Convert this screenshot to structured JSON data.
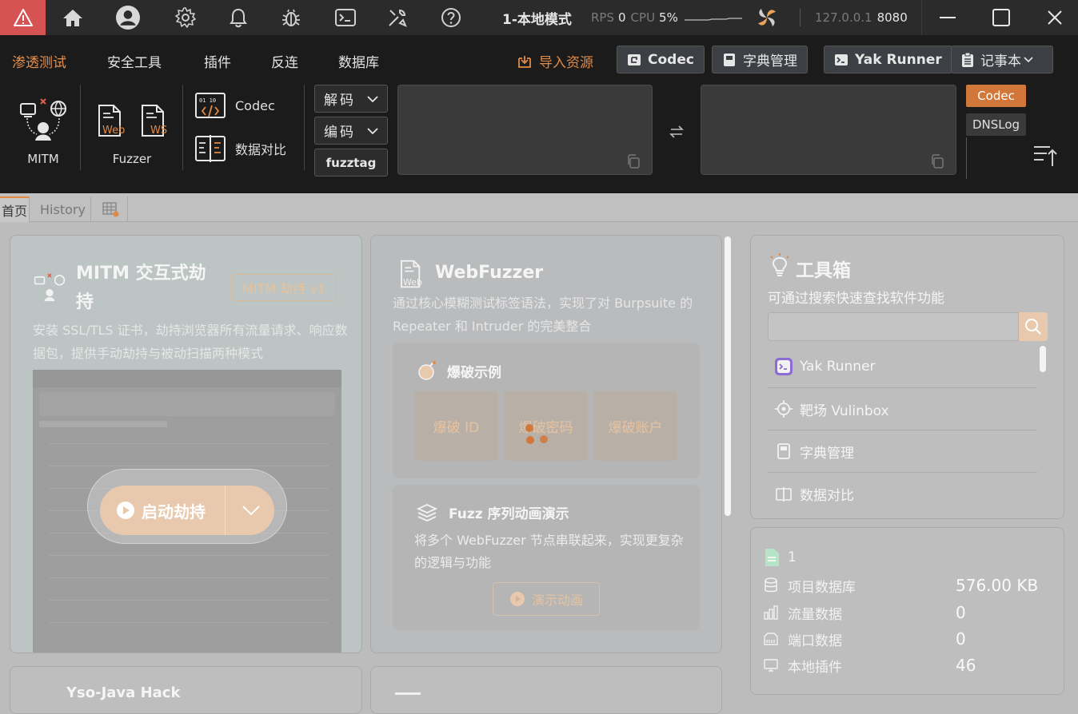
{
  "titlebar": {
    "mode": "1-本地模式",
    "rps_label": "RPS",
    "rps_value": "0",
    "cpu_label": "CPU",
    "cpu_value": "5%",
    "host": "127.0.0.1",
    "port": "8080",
    "icons": [
      "warning-icon",
      "home-icon",
      "user-icon",
      "gear-icon",
      "bell-icon",
      "bug-icon",
      "terminal-icon",
      "tools-icon",
      "help-icon",
      "sparkline-icon",
      "plugin-logo-icon"
    ]
  },
  "menu": {
    "items": [
      "渗透测试",
      "安全工具",
      "插件",
      "反连",
      "数据库"
    ],
    "import_label": "导入资源",
    "buttons": [
      "Codec",
      "字典管理",
      "Yak Runner",
      "记事本"
    ]
  },
  "tools": {
    "mitm": "MITM",
    "fuzzer": "Fuzzer",
    "web_label": "Web",
    "ws_label": "WS",
    "codec": "Codec",
    "compare": "数据对比",
    "decode": "解码",
    "encode": "编码",
    "fuzztag": "fuzztag",
    "codec_tab": "Codec",
    "dnslog_tab": "DNSLog"
  },
  "tabs": {
    "home": "首页",
    "history": "History"
  },
  "mitm_card": {
    "title": "MITM 交互式劫持",
    "badge": "MITM 劫持 v1",
    "desc": "安装 SSL/TLS 证书，劫持浏览器所有流量请求、响应数据包，提供手动劫持与被动扫描两种模式",
    "start": "启动劫持"
  },
  "webfuzzer_card": {
    "title": "WebFuzzer",
    "icon_label": "Web",
    "desc": "通过核心模糊测试标签语法，实现了对 Burpsuite 的 Repeater 和 Intruder 的完美整合",
    "burst_title": "爆破示例",
    "burst_items": [
      "爆破 ID",
      "爆破密码",
      "爆破账户"
    ],
    "seq_title": "Fuzz 序列动画演示",
    "seq_desc": "将多个 WebFuzzer 节点串联起来，实现更复杂的逻辑与功能",
    "demo": "演示动画"
  },
  "toolbox": {
    "title": "工具箱",
    "desc": "可通过搜索快速查找软件功能",
    "items": [
      "Yak Runner",
      "靶场 Vulinbox",
      "字典管理",
      "数据对比"
    ]
  },
  "info": {
    "project": "1",
    "rows": [
      {
        "label": "项目数据库",
        "value": "576.00 KB"
      },
      {
        "label": "流量数据",
        "value": "0"
      },
      {
        "label": "端口数据",
        "value": "0"
      },
      {
        "label": "本地插件",
        "value": "46"
      }
    ]
  },
  "yso_card": {
    "title": "Yso-Java Hack"
  },
  "colors": {
    "accent": "#e08a46",
    "warning": "#d65353",
    "codec_tab": "#d2773a",
    "titlebar": "#2b2b2b",
    "menubar": "#1b1b1b"
  }
}
